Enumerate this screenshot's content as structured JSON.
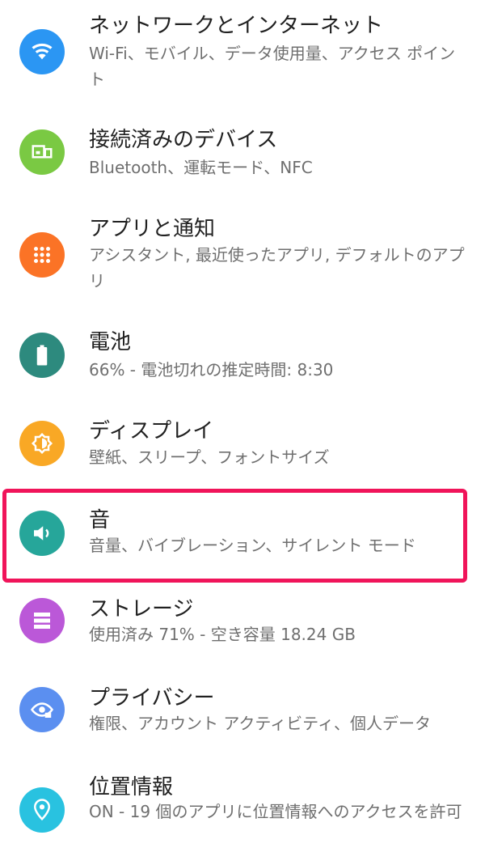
{
  "settings": {
    "items": [
      {
        "title": "ネットワークとインターネット",
        "subtitle": "Wi-Fi、モバイル、データ使用量、アクセス ポイント",
        "icon": "wifi-icon",
        "color": "#2b96f3"
      },
      {
        "title": "接続済みのデバイス",
        "subtitle": "Bluetooth、運転モード、NFC",
        "icon": "connected-devices-icon",
        "color": "#7ac943"
      },
      {
        "title": "アプリと通知",
        "subtitle": "アシスタント, 最近使ったアプリ, デフォルトのアプリ",
        "icon": "apps-grid-icon",
        "color": "#fb7326"
      },
      {
        "title": "電池",
        "subtitle": "66% - 電池切れの推定時間: 8:30",
        "icon": "battery-icon",
        "color": "#2d8a7e"
      },
      {
        "title": "ディスプレイ",
        "subtitle": "壁紙、スリープ、フォントサイズ",
        "icon": "brightness-icon",
        "color": "#f9a825"
      },
      {
        "title": "音",
        "subtitle": "音量、バイブレーション、サイレント モード",
        "icon": "volume-icon",
        "color": "#26a69a"
      },
      {
        "title": "ストレージ",
        "subtitle": "使用済み 71% - 空き容量 18.24 GB",
        "icon": "storage-icon",
        "color": "#bb58d8"
      },
      {
        "title": "プライバシー",
        "subtitle": "権限、アカウント アクティビティ、個人データ",
        "icon": "privacy-eye-icon",
        "color": "#5b8ff0"
      },
      {
        "title": "位置情報",
        "subtitle": "ON - 19 個のアプリに位置情報へのアクセスを許可",
        "icon": "location-pin-icon",
        "color": "#29c2e0"
      }
    ],
    "highlight_color": "#f0145a"
  }
}
